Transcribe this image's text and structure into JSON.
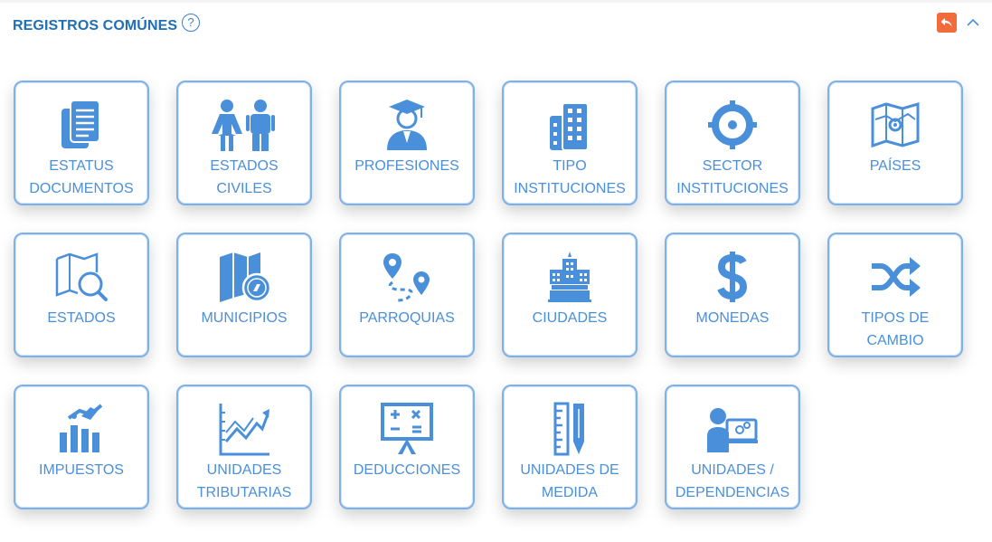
{
  "header": {
    "title": "REGISTROS COMÚNES",
    "help_glyph": "?",
    "undo_icon": "undo-arrow-icon",
    "collapse_icon": "chevron-up-icon"
  },
  "colors": {
    "accent": "#4a8fda",
    "title": "#1f6fb5",
    "undo_bg": "#f26b3a"
  },
  "tiles": [
    {
      "line1": "ESTATUS",
      "line2": "DOCUMENTOS",
      "icon": "documents-icon"
    },
    {
      "line1": "ESTADOS",
      "line2": "CIVILES",
      "icon": "couple-icon"
    },
    {
      "line1": "PROFESIONES",
      "line2": "",
      "icon": "graduate-icon"
    },
    {
      "line1": "TIPO",
      "line2": "INSTITUCIONES",
      "icon": "buildings-icon"
    },
    {
      "line1": "SECTOR",
      "line2": "INSTITUCIONES",
      "icon": "crosshair-icon"
    },
    {
      "line1": "PAÍSES",
      "line2": "",
      "icon": "world-map-icon"
    },
    {
      "line1": "ESTADOS",
      "line2": "",
      "icon": "map-search-icon"
    },
    {
      "line1": "MUNICIPIOS",
      "line2": "",
      "icon": "map-compass-icon"
    },
    {
      "line1": "PARROQUIAS",
      "line2": "",
      "icon": "route-pins-icon"
    },
    {
      "line1": "CIUDADES",
      "line2": "",
      "icon": "hotel-icon"
    },
    {
      "line1": "MONEDAS",
      "line2": "",
      "icon": "dollar-icon"
    },
    {
      "line1": "TIPOS DE CAMBIO",
      "line2": "",
      "icon": "shuffle-icon"
    },
    {
      "line1": "IMPUESTOS",
      "line2": "",
      "icon": "tax-chart-icon"
    },
    {
      "line1": "UNIDADES",
      "line2": "TRIBUTARIAS",
      "icon": "line-chart-icon"
    },
    {
      "line1": "DEDUCCIONES",
      "line2": "",
      "icon": "math-board-icon"
    },
    {
      "line1": "UNIDADES DE",
      "line2": "MEDIDA",
      "icon": "ruler-pencil-icon"
    },
    {
      "line1": "UNIDADES /",
      "line2": "DEPENDENCIAS",
      "icon": "user-computer-icon"
    }
  ]
}
